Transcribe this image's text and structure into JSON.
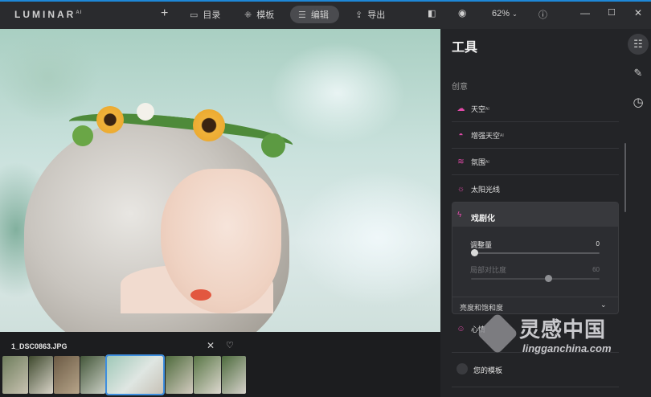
{
  "app": {
    "brand": "LUMINAR",
    "brand_suffix": "AI"
  },
  "toolbar": {
    "add_label": "+",
    "catalog_label": "目录",
    "templates_label": "模板",
    "edit_label": "编辑",
    "export_label": "导出",
    "zoom_value": "62%",
    "active_tab": "编辑"
  },
  "photo": {
    "filename": "1_DSC0863.JPG"
  },
  "panel": {
    "title": "工具",
    "section": "创意",
    "tools": [
      {
        "label": "天空",
        "ai": "AI",
        "icon": "cloud-icon",
        "color": "#e04aa8"
      },
      {
        "label": "增强天空",
        "ai": "AI",
        "icon": "sky-enhance-icon",
        "color": "#e04aa8"
      },
      {
        "label": "氛围",
        "ai": "AI",
        "icon": "atmosphere-icon",
        "color": "#e04aa8"
      },
      {
        "label": "太阳光线",
        "ai": "",
        "icon": "sun-rays-icon",
        "color": "#e04aa8"
      }
    ],
    "expanded_tool": {
      "label": "戏剧化",
      "icon": "drama-icon",
      "sliders": [
        {
          "label": "调整量",
          "value": "0",
          "fraction": 0.0,
          "enabled": true
        },
        {
          "label": "局部对比度",
          "value": "60",
          "fraction": 0.6,
          "enabled": false
        }
      ],
      "subsection": "亮度和饱和度"
    },
    "more_tools": [
      {
        "label": "心情",
        "icon": "mood-icon"
      },
      {
        "label": "您的模板",
        "icon": "preset-icon"
      }
    ]
  },
  "watermark": {
    "title": "灵感中国",
    "url": "lingganchina.com"
  },
  "colors": {
    "accent": "#1e88d8",
    "creative_pink": "#e04aa8",
    "selection_blue": "#3f8fdf"
  }
}
